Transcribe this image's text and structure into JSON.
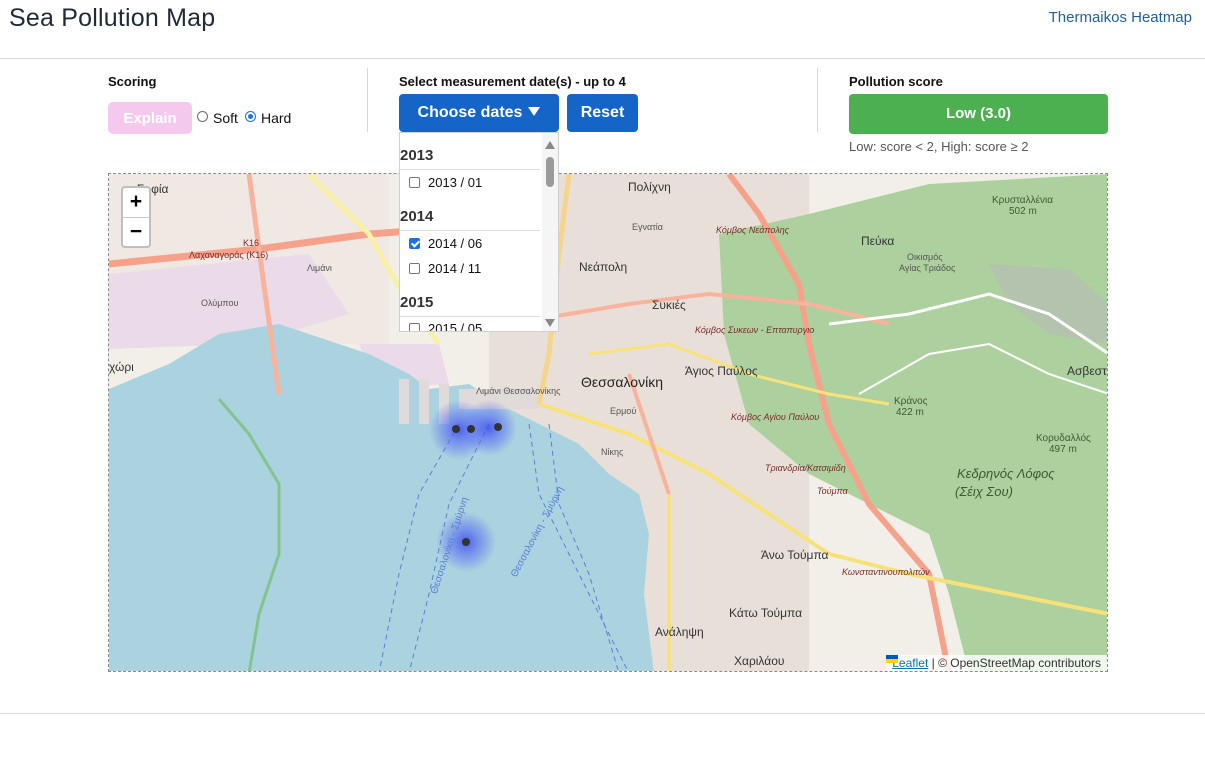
{
  "header": {
    "title": "Sea Pollution Map",
    "nav_link": "Thermaikos Heatmap"
  },
  "scoring": {
    "label": "Scoring",
    "explain_label": "Explain",
    "options": [
      "Soft",
      "Hard"
    ],
    "selected": "Hard"
  },
  "dates": {
    "label": "Select measurement date(s) - up to 4",
    "choose_label": "Choose dates",
    "reset_label": "Reset",
    "dropdown": [
      {
        "year": "2013",
        "items": [
          {
            "label": "2013 / 01",
            "checked": false
          }
        ]
      },
      {
        "year": "2014",
        "items": [
          {
            "label": "2014 / 06",
            "checked": true
          },
          {
            "label": "2014 / 11",
            "checked": false
          }
        ]
      },
      {
        "year": "2015",
        "items": [
          {
            "label": "2015 / 05",
            "checked": false
          }
        ]
      }
    ]
  },
  "pollution": {
    "label": "Pollution score",
    "value": "Low (3.0)",
    "note": "Low: score < 2, High: score ≥ 2",
    "color": "#4caf50"
  },
  "map": {
    "zoom_in": "+",
    "zoom_out": "−",
    "attribution_link": "Leaflet",
    "attribution_text": "| © OpenStreetMap contributors",
    "place_labels": {
      "thessaloniki": "Θεσσαλονίκη",
      "polichni": "Πολίχνη",
      "neapoli": "Νεάπολη",
      "sykies": "Συκιές",
      "agios_pavlos": "Άγιος Παύλος",
      "pefka": "Πεύκα",
      "asvestochori": "Ασβεστο",
      "ano_toumpa": "Άνω Τούμπα",
      "kato_toumpa": "Κάτω Τούμπα",
      "analipsi": "Ανάληψη",
      "charilaou": "Χαριλάου",
      "kedrinos_lofos": "Κεδρηνός Λόφος",
      "seich_sou": "(Σέιχ Σου)",
      "limani": "Λιμάνι Θεσσαλονίκης",
      "krania": "Κράνος",
      "krania_alt": "422 m",
      "korydallos": "Κορυδαλλός",
      "korydallos_alt": "497 m",
      "krystallenia": "Κρυσταλλένια",
      "krystallenia_alt": "502 m",
      "oikismos": "Οικισμός",
      "agios_tryfonas": "Αγίας Τριάδος",
      "sofia": "Σοφία",
      "xori": "χώρι",
      "lachanagora": "Λαχαναγοράς (K16)",
      "k16": "K16",
      "limani_small": "Λιμάνι",
      "olympou": "Ολύμπου",
      "kombos_neapolis": "Κόμβος Νεάπολης",
      "kombos_sykeon": "Κόμβος Συκεων - Επταπυργιο",
      "kombos_agiou_pavlou": "Κόμβος Αγίου Παύλου",
      "triandria": "Τριανδρία/Κατσιμίδη",
      "toumpa_k8": "Τούμπα",
      "konstantinoupoleos": "Κωνσταντινουπολιτών",
      "egnatia": "Εγνατία",
      "erm": "Ερμού",
      "nikis": "Νίκης",
      "route_label": "Θεσσαλονίκη - Σμύρνη",
      "route_label_2": "Θεσσαλονίκη - Σμύρνη"
    }
  }
}
